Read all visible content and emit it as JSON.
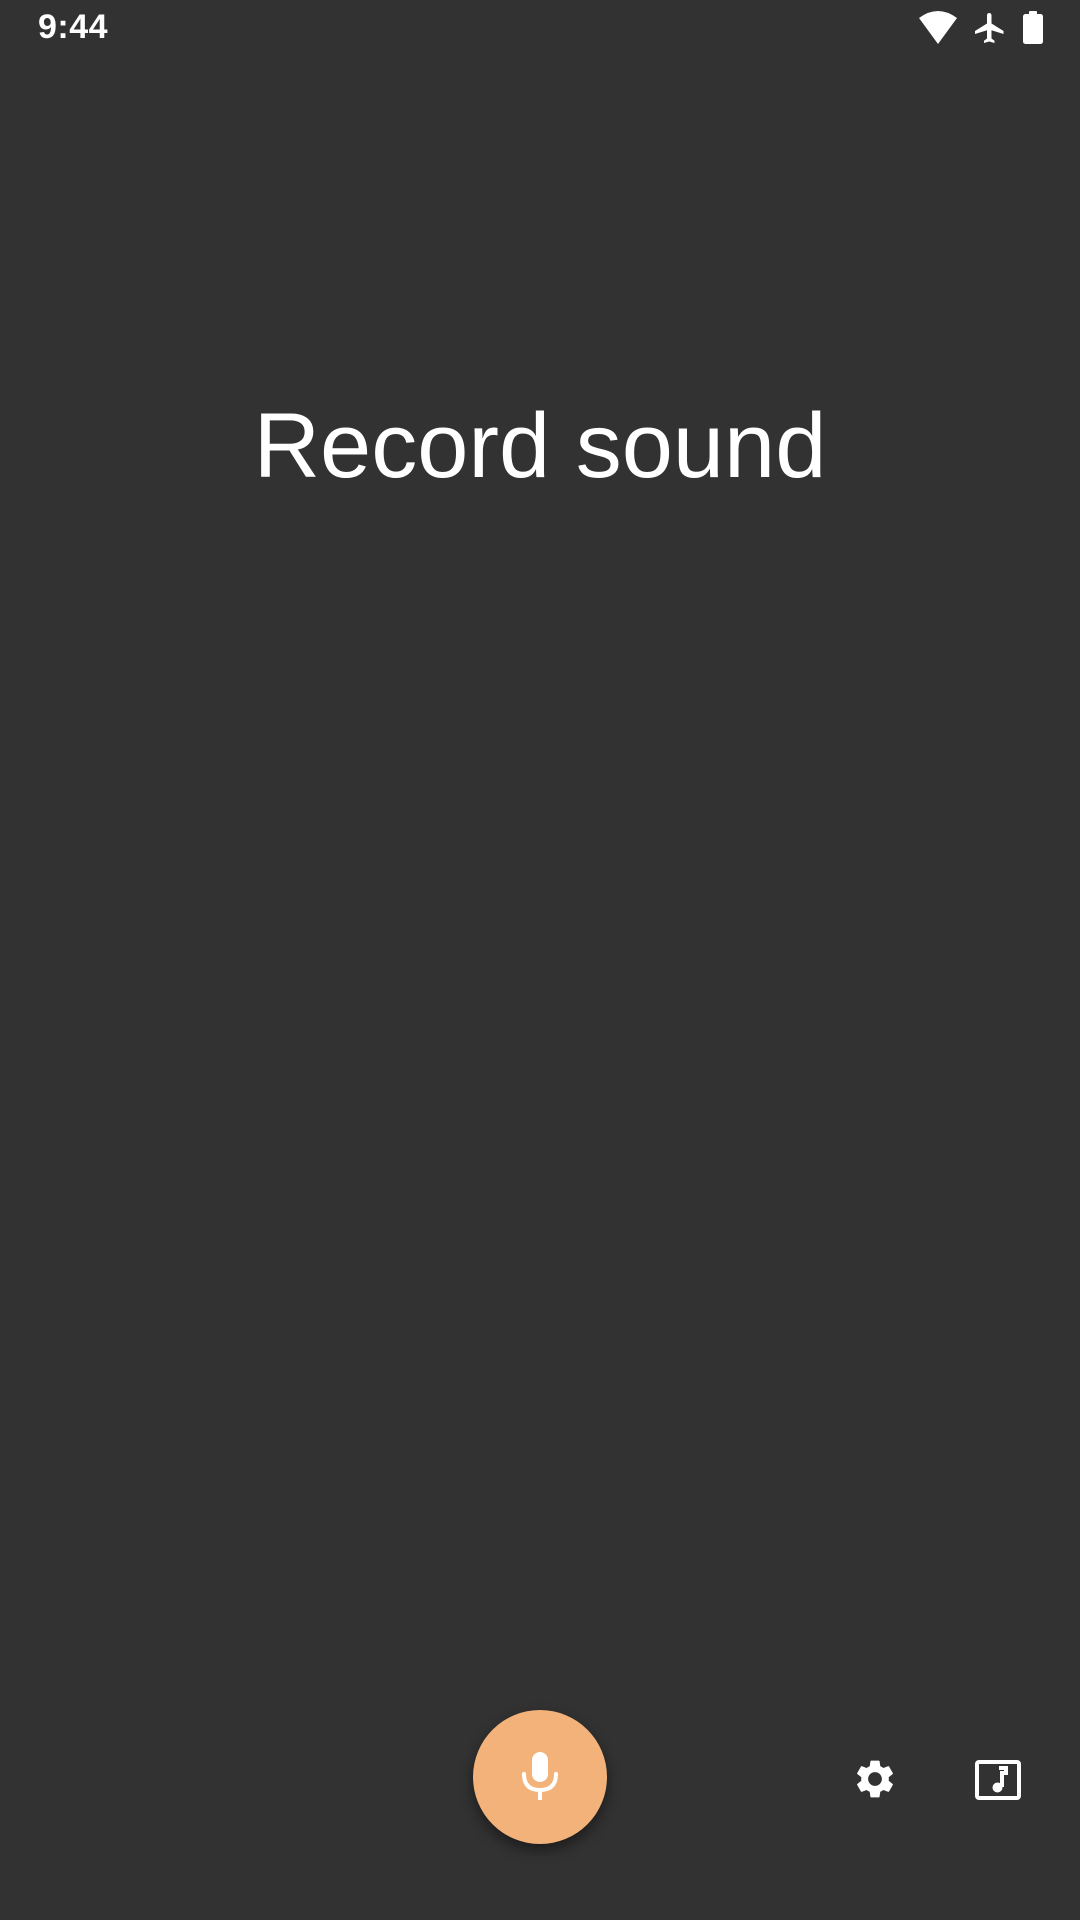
{
  "status_bar": {
    "time": "9:44",
    "icons": [
      "wifi-icon",
      "airplane-mode-icon",
      "battery-icon"
    ]
  },
  "main": {
    "title": "Record sound"
  },
  "controls": {
    "record_icon": "microphone-icon",
    "settings_icon": "gear-icon",
    "library_icon": "music-library-icon",
    "record_button_color": "#f2b27a"
  },
  "colors": {
    "background": "#323232",
    "text": "#ffffff",
    "accent": "#f2b27a"
  }
}
